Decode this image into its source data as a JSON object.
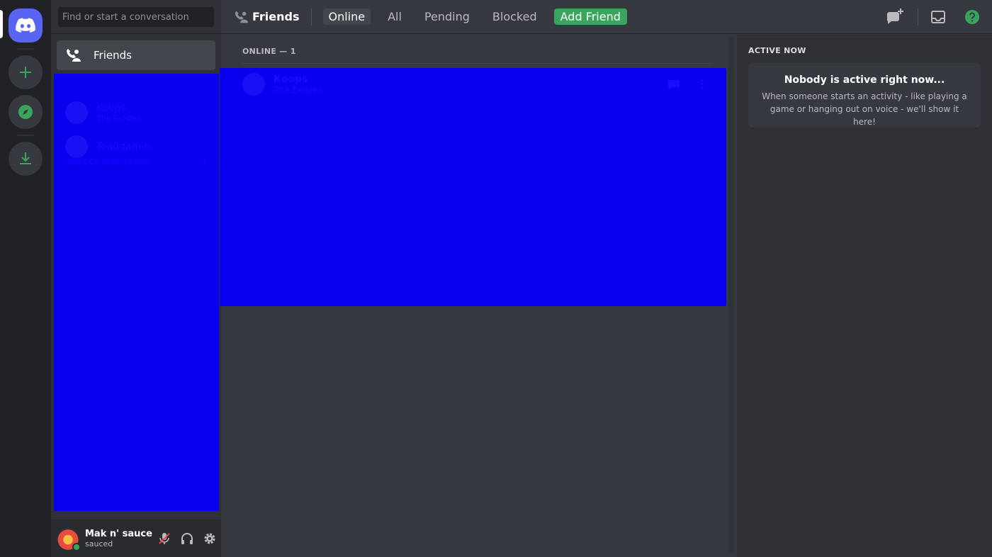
{
  "search": {
    "placeholder": "Find or start a conversation"
  },
  "sidebar": {
    "friends_label": "Friends",
    "dm_header": "DIRECT MESSAGES",
    "dm_add": "+",
    "dms": [
      {
        "name": "Koops",
        "sub": "The Exister"
      },
      {
        "name": "Toadgamin",
        "sub": ""
      }
    ]
  },
  "user": {
    "name": "Mak n' sauce",
    "status": "sauced",
    "status_color": "#3ba55d"
  },
  "topbar": {
    "title": "Friends",
    "tabs": [
      "Online",
      "All",
      "Pending",
      "Blocked"
    ],
    "add_friend": "Add Friend"
  },
  "main": {
    "online_header": "ONLINE — 1",
    "friends": [
      {
        "name": "Koops",
        "sub": "The Exister"
      }
    ]
  },
  "active_now": {
    "title": "ACTIVE NOW",
    "heading": "Nobody is active right now...",
    "body": "When someone starts an activity - like playing a game or hanging out on voice - we'll show it here!"
  },
  "colors": {
    "brand": "#5865f2",
    "green": "#3ba55d",
    "redaction": "#0a00f0"
  }
}
